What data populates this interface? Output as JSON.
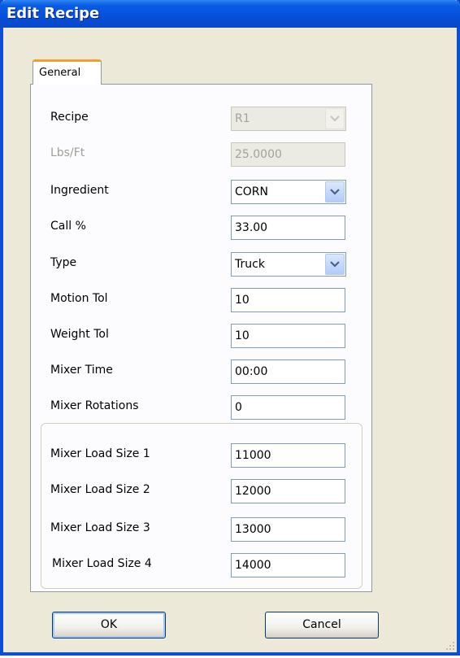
{
  "window": {
    "title": "Edit Recipe"
  },
  "tabs": [
    {
      "label": "General"
    }
  ],
  "form": {
    "recipe": {
      "label": "Recipe",
      "value": "R1"
    },
    "lbs_ft": {
      "label": "Lbs/Ft",
      "value": "25.0000"
    },
    "ingredient": {
      "label": "Ingredient",
      "value": "CORN"
    },
    "call_pct": {
      "label": "Call %",
      "value": "33.00"
    },
    "type": {
      "label": "Type",
      "value": "Truck"
    },
    "motion_tol": {
      "label": "Motion Tol",
      "value": "10"
    },
    "weight_tol": {
      "label": "Weight Tol",
      "value": "10"
    },
    "mixer_time": {
      "label": "Mixer Time",
      "value": "00:00"
    },
    "mixer_rot": {
      "label": "Mixer Rotations",
      "value": "0"
    }
  },
  "load_sizes": [
    {
      "label": "Mixer Load Size 1",
      "value": "11000"
    },
    {
      "label": "Mixer Load Size 2",
      "value": "12000"
    },
    {
      "label": "Mixer Load Size 3",
      "value": "13000"
    },
    {
      "label": "Mixer Load Size 4",
      "value": "14000"
    }
  ],
  "buttons": {
    "ok": "OK",
    "cancel": "Cancel"
  },
  "icons": {
    "dropdown": "chevron-down-icon",
    "resize": "resize-grip-icon"
  },
  "colors": {
    "title_bar": "#0a5ce3",
    "tab_accent": "#f0a030",
    "dialog_bg": "#ece9d8"
  }
}
